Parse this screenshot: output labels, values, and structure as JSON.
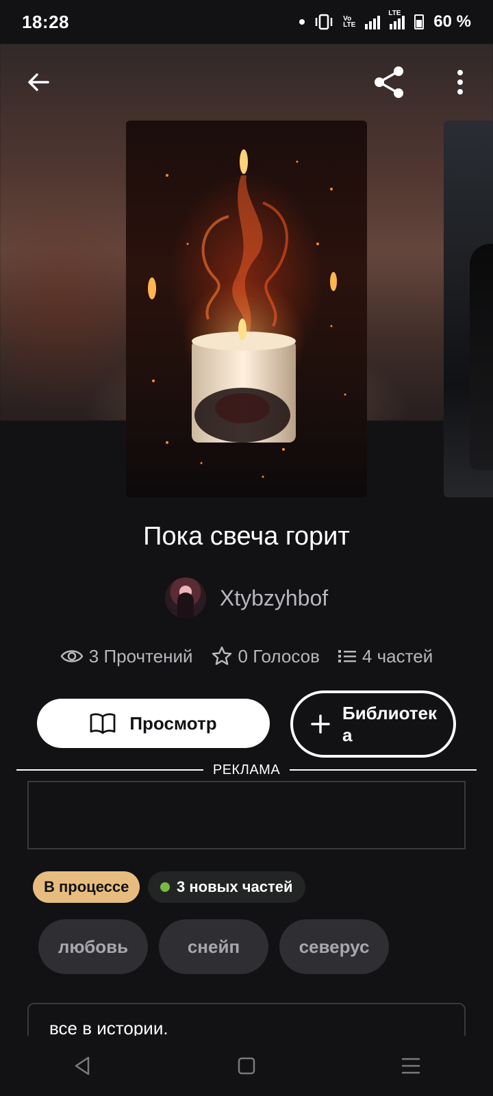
{
  "status_bar": {
    "time": "18:28",
    "volte_label": "Vo\nLTE",
    "lte_label": "LTE",
    "battery": "60 %"
  },
  "toolbar": {
    "back_icon": "arrow-left-icon",
    "share_icon": "share-icon",
    "more_icon": "more-vertical-icon"
  },
  "story": {
    "title": "Пока свеча горит",
    "author": "Xtybzyhbof",
    "stats": {
      "reads": "3 Прочтений",
      "votes": "0 Голосов",
      "parts": "4 частей"
    }
  },
  "actions": {
    "read_label": "Просмотр",
    "library_label": "Библиотека"
  },
  "ad": {
    "label": "РЕКЛАМА"
  },
  "badges": {
    "status": "В процессе",
    "new_parts": "3 новых частей"
  },
  "tags": [
    "любовь",
    "снейп",
    "северус"
  ],
  "description": {
    "text": "все в истории."
  },
  "colors": {
    "background": "#121114",
    "status_chip": "#e7bd7f",
    "new_dot": "#7ab940",
    "tag_bg": "#2f2e32"
  }
}
